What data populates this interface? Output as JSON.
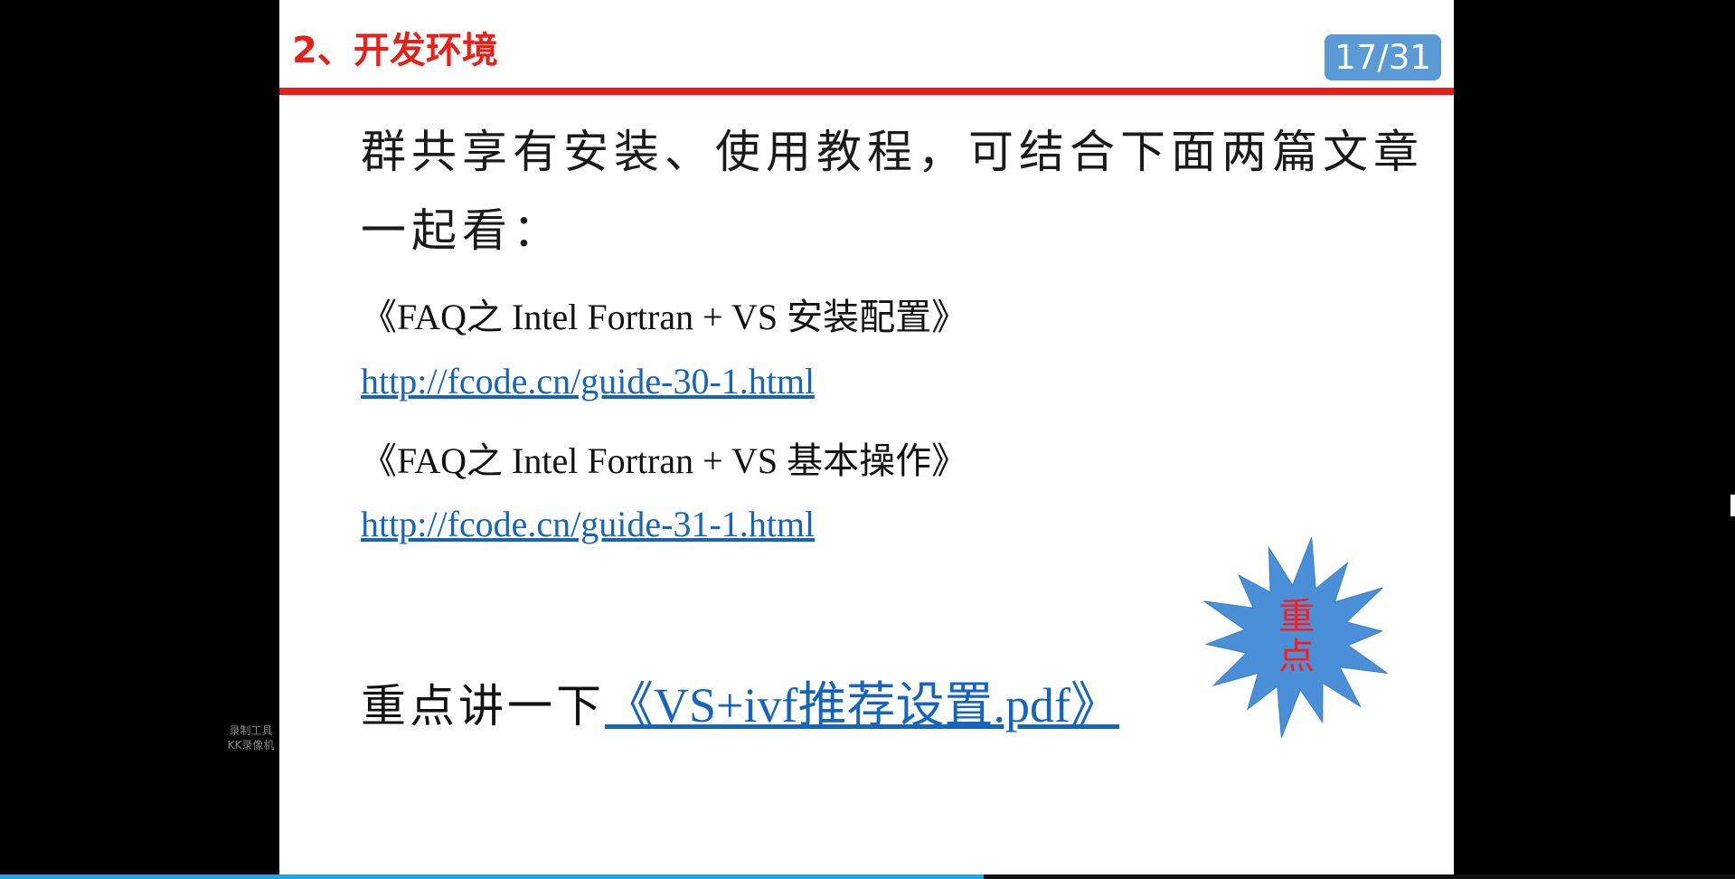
{
  "slide": {
    "title": "2、开发环境",
    "page_counter": "17/31",
    "intro_text": "群共享有安装、使用教程，可结合下面两篇文章一起看：",
    "articles": [
      {
        "title": "《FAQ之 Intel Fortran + VS 安装配置》",
        "url": "http://fcode.cn/guide-30-1.html"
      },
      {
        "title": "《FAQ之 Intel Fortran + VS 基本操作》",
        "url": "http://fcode.cn/guide-31-1.html"
      }
    ],
    "emphasis_lead": "重点讲一下",
    "emphasis_link": "《VS+ivf推荐设置.pdf》",
    "burst_line1": "重",
    "burst_line2": "点"
  },
  "watermark": {
    "line1": "录制工具",
    "line2": "KK录像机"
  },
  "playback": {
    "progress": 0.567
  },
  "colors": {
    "title_red": "#e8201a",
    "rule_red": "#ee1c16",
    "counter_blue": "#5b9bd5",
    "link_blue": "#1565c0",
    "burst_blue": "#4a90d9",
    "progress_blue": "#1aa8e8"
  }
}
